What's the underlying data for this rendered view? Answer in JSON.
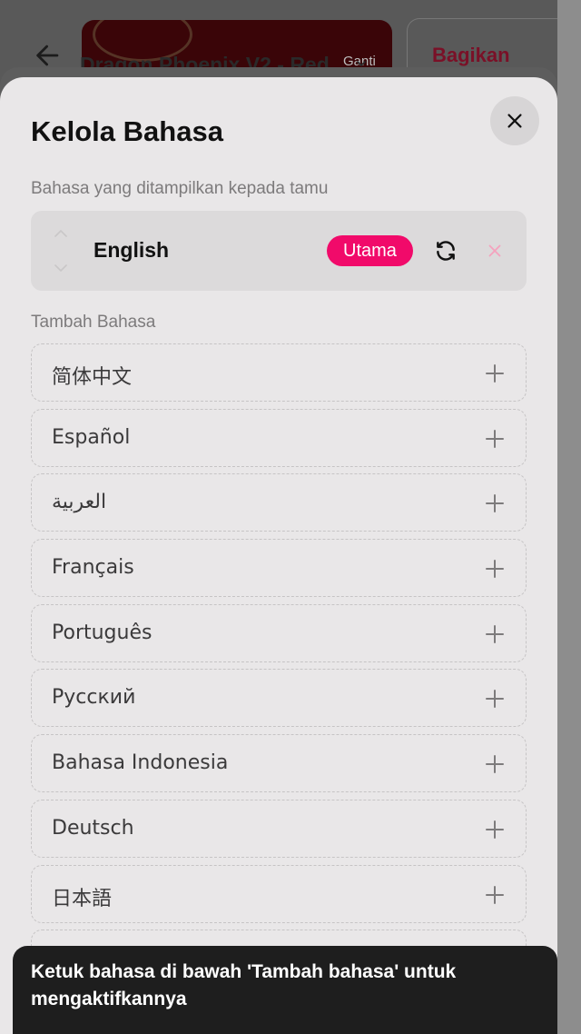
{
  "background": {
    "change_template_label": "Ganti Template",
    "template_title": "Dragon Phoenix V2 - Red",
    "share_label": "Bagikan"
  },
  "modal": {
    "title": "Kelola Bahasa",
    "active_section_label": "Bahasa yang ditampilkan kepada tamu",
    "active_languages": [
      {
        "name": "English",
        "badge": "Utama"
      }
    ],
    "add_section_label": "Tambah Bahasa",
    "available_languages": [
      "简体中文",
      "Español",
      "العربية",
      "Français",
      "Português",
      "Русский",
      "Bahasa Indonesia",
      "Deutsch",
      "日本語",
      ""
    ]
  },
  "toast": {
    "message": "Ketuk bahasa di bawah 'Tambah bahasa' untuk mengaktifkannya"
  },
  "colors": {
    "accent": "#f10a6a",
    "sheet_bg": "#e9e7e8",
    "toast_bg": "#1e1e1e"
  },
  "icons": [
    "back-arrow-icon",
    "chevron-down-icon",
    "close-icon",
    "drag-handle-icon",
    "swap-icon",
    "remove-icon",
    "plus-icon"
  ]
}
